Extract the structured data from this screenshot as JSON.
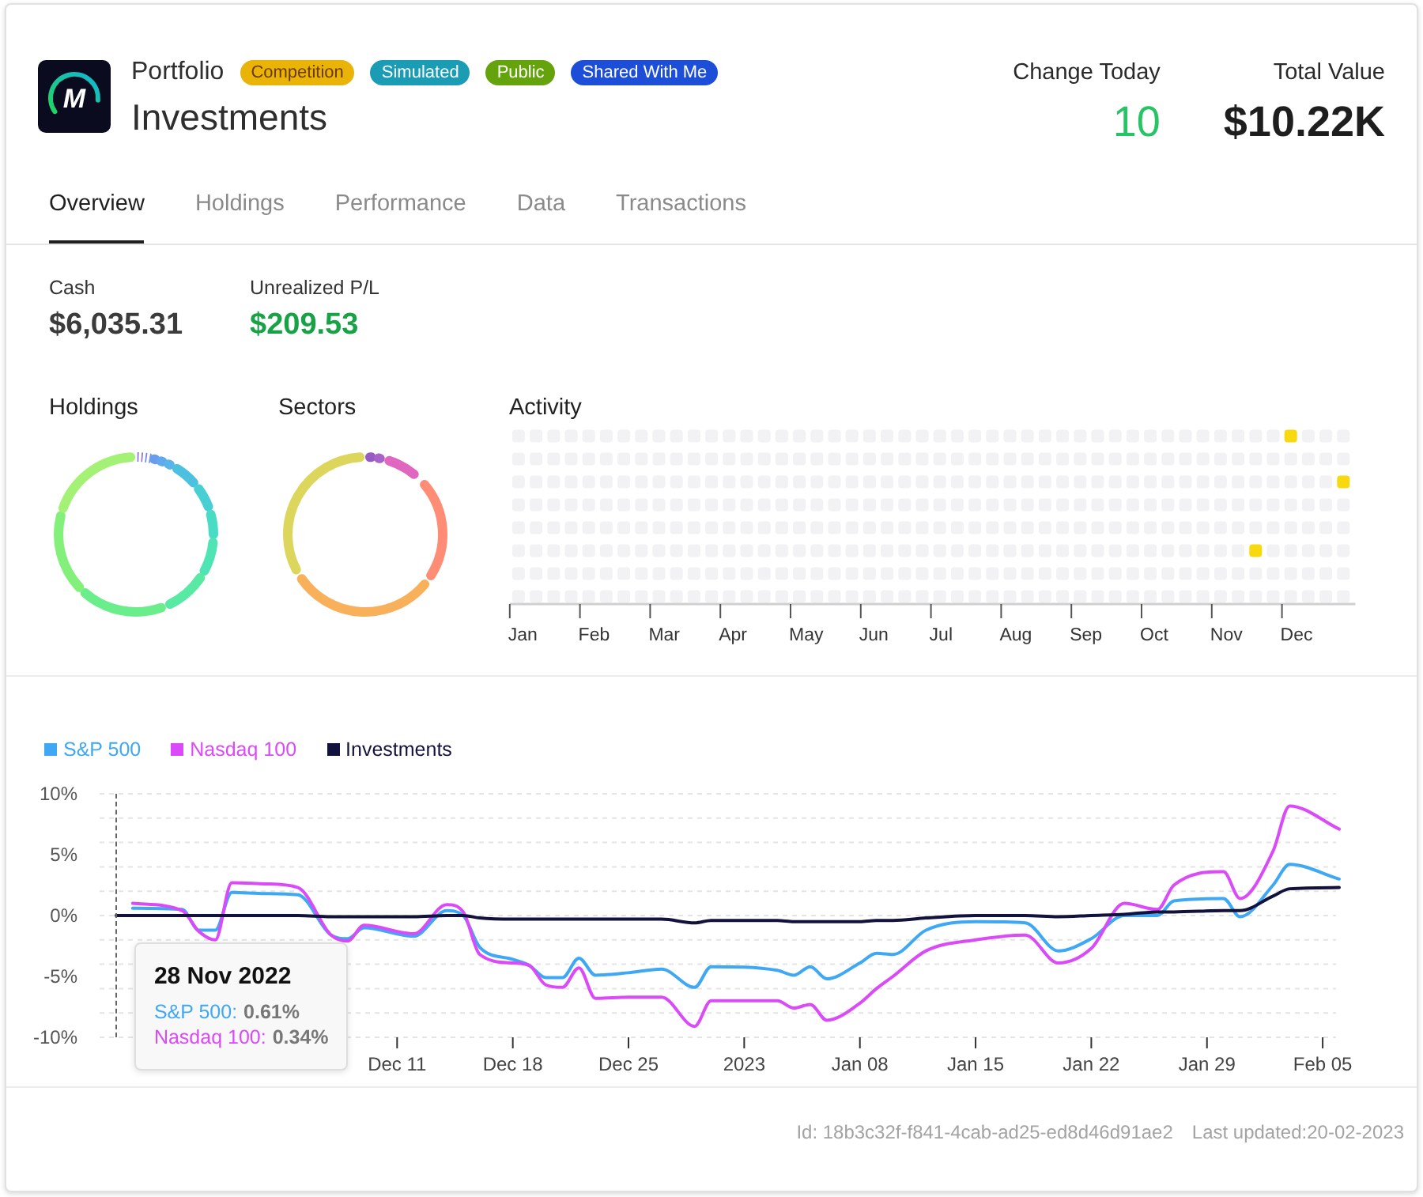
{
  "header": {
    "logo_text": "M",
    "subtitle": "Portfolio",
    "title": "Investments",
    "badges": [
      {
        "label": "Competition",
        "color": "#eab308"
      },
      {
        "label": "Simulated",
        "color": "#1a9cb5"
      },
      {
        "label": "Public",
        "color": "#65a30d"
      },
      {
        "label": "Shared With Me",
        "color": "#1d4ed8"
      }
    ],
    "stats": [
      {
        "label": "Change Today",
        "value": "10",
        "kind": "change"
      },
      {
        "label": "Total Value",
        "value": "$10.22K",
        "kind": "total"
      }
    ]
  },
  "tabs": [
    {
      "label": "Overview",
      "selected": true
    },
    {
      "label": "Holdings",
      "selected": false
    },
    {
      "label": "Performance",
      "selected": false
    },
    {
      "label": "Data",
      "selected": false
    },
    {
      "label": "Transactions",
      "selected": false
    }
  ],
  "metrics": [
    {
      "label": "Cash",
      "value": "$6,035.31",
      "kind": "balance"
    },
    {
      "label": "Unrealized P/L",
      "value": "$209.53",
      "kind": "gain"
    }
  ],
  "holdings": {
    "title": "Holdings"
  },
  "sectors": {
    "title": "Sectors"
  },
  "activity": {
    "title": "Activity",
    "months": [
      "Jan",
      "Feb",
      "Mar",
      "Apr",
      "May",
      "Jun",
      "Jul",
      "Aug",
      "Sep",
      "Oct",
      "Nov",
      "Dec"
    ],
    "grid": [
      [
        false,
        false,
        false,
        false,
        false,
        false,
        false,
        false,
        false,
        false,
        false,
        false,
        false,
        false,
        false,
        false,
        false,
        false,
        false,
        false,
        false,
        false,
        false,
        false,
        false,
        false,
        false,
        false,
        false,
        false,
        false,
        false,
        false,
        false,
        false,
        false,
        false,
        false,
        false,
        false,
        false,
        false,
        false,
        false,
        true,
        false,
        false,
        false
      ],
      [
        false,
        false,
        false,
        false,
        false,
        false,
        false,
        false,
        false,
        false,
        false,
        false,
        false,
        false,
        false,
        false,
        false,
        false,
        false,
        false,
        false,
        false,
        false,
        false,
        false,
        false,
        false,
        false,
        false,
        false,
        false,
        false,
        false,
        false,
        false,
        false,
        false,
        false,
        false,
        false,
        false,
        false,
        false,
        false,
        false,
        false,
        false,
        false
      ],
      [
        false,
        false,
        false,
        false,
        false,
        false,
        false,
        false,
        false,
        false,
        false,
        false,
        false,
        false,
        false,
        false,
        false,
        false,
        false,
        false,
        false,
        false,
        false,
        false,
        false,
        false,
        false,
        false,
        false,
        false,
        false,
        false,
        false,
        false,
        false,
        false,
        false,
        false,
        false,
        false,
        false,
        false,
        false,
        false,
        false,
        false,
        false,
        true
      ],
      [
        false,
        false,
        false,
        false,
        false,
        false,
        false,
        false,
        false,
        false,
        false,
        false,
        false,
        false,
        false,
        false,
        false,
        false,
        false,
        false,
        false,
        false,
        false,
        false,
        false,
        false,
        false,
        false,
        false,
        false,
        false,
        false,
        false,
        false,
        false,
        false,
        false,
        false,
        false,
        false,
        false,
        false,
        false,
        false,
        false,
        false,
        false,
        false
      ],
      [
        false,
        false,
        false,
        false,
        false,
        false,
        false,
        false,
        false,
        false,
        false,
        false,
        false,
        false,
        false,
        false,
        false,
        false,
        false,
        false,
        false,
        false,
        false,
        false,
        false,
        false,
        false,
        false,
        false,
        false,
        false,
        false,
        false,
        false,
        false,
        false,
        false,
        false,
        false,
        false,
        false,
        false,
        false,
        false,
        false,
        false,
        false,
        false
      ],
      [
        false,
        false,
        false,
        false,
        false,
        false,
        false,
        false,
        false,
        false,
        false,
        false,
        false,
        false,
        false,
        false,
        false,
        false,
        false,
        false,
        false,
        false,
        false,
        false,
        false,
        false,
        false,
        false,
        false,
        false,
        false,
        false,
        false,
        false,
        false,
        false,
        false,
        false,
        false,
        false,
        false,
        false,
        true,
        false,
        false,
        false,
        false,
        false
      ],
      [
        false,
        false,
        false,
        false,
        false,
        false,
        false,
        false,
        false,
        false,
        false,
        false,
        false,
        false,
        false,
        false,
        false,
        false,
        false,
        false,
        false,
        false,
        false,
        false,
        false,
        false,
        false,
        false,
        false,
        false,
        false,
        false,
        false,
        false,
        false,
        false,
        false,
        false,
        false,
        false,
        false,
        false,
        false,
        false,
        false,
        false,
        false,
        false
      ],
      [
        false,
        false,
        false,
        false,
        false,
        false,
        false,
        false,
        false,
        false,
        false,
        false,
        false,
        false,
        false,
        false,
        false,
        false,
        false,
        false,
        false,
        false,
        false,
        false,
        false,
        false,
        false,
        false,
        false,
        false,
        false,
        false,
        false,
        false,
        false,
        false,
        false,
        false,
        false,
        false,
        false,
        false,
        false,
        false,
        false,
        false,
        false,
        false
      ]
    ]
  },
  "performance_chart": {
    "chart_data": {
      "type": "line",
      "x": [
        "2022-11-24",
        "2022-11-25",
        "2022-11-28",
        "2022-11-29",
        "2022-11-30",
        "2022-12-01",
        "2022-12-03",
        "2022-12-05",
        "2022-12-07",
        "2022-12-08",
        "2022-12-09",
        "2022-12-12",
        "2022-12-14",
        "2022-12-15",
        "2022-12-16",
        "2022-12-18",
        "2022-12-19",
        "2022-12-20",
        "2022-12-21",
        "2022-12-22",
        "2022-12-23",
        "2022-12-25",
        "2022-12-27",
        "2022-12-29",
        "2022-12-30",
        "2023-01-03",
        "2023-01-04",
        "2023-01-05",
        "2023-01-06",
        "2023-01-08",
        "2023-01-09",
        "2023-01-10",
        "2023-01-12",
        "2023-01-15",
        "2023-01-18",
        "2023-01-20",
        "2023-01-22",
        "2023-01-24",
        "2023-01-26",
        "2023-01-27",
        "2023-01-30",
        "2023-01-31",
        "2023-02-02",
        "2023-02-03",
        "2023-02-06"
      ],
      "series": [
        {
          "name": "S&P 500",
          "color": "#3ea8f5",
          "values": [
            null,
            0.6,
            0.5,
            -1.2,
            -1.2,
            1.9,
            1.8,
            1.7,
            -1.6,
            -1.9,
            -1.0,
            -1.7,
            0.4,
            0.0,
            -2.6,
            -3.6,
            -4.1,
            -5.1,
            -5.1,
            -3.5,
            -4.9,
            -4.7,
            -4.4,
            -5.9,
            -4.2,
            -4.5,
            -4.9,
            -4.2,
            -5.2,
            -3.9,
            -3.1,
            -3.2,
            -1.2,
            -0.5,
            -0.6,
            -2.9,
            -1.9,
            0.0,
            0.0,
            1.2,
            1.4,
            -0.1,
            2.5,
            4.2,
            3.0
          ]
        },
        {
          "name": "Nasdaq 100",
          "color": "#db4af8",
          "values": [
            null,
            1.0,
            0.4,
            -1.3,
            -2.0,
            2.7,
            2.6,
            2.3,
            -1.6,
            -2.1,
            -0.8,
            -1.5,
            0.9,
            0.3,
            -3.2,
            -3.9,
            -4.1,
            -5.7,
            -5.9,
            -4.3,
            -6.8,
            -6.7,
            -6.7,
            -9.1,
            -7.0,
            -7.0,
            -7.6,
            -7.3,
            -8.6,
            -7.2,
            -6.0,
            -5.0,
            -2.9,
            -2.0,
            -1.6,
            -3.9,
            -2.7,
            1.0,
            0.5,
            2.5,
            3.6,
            1.4,
            5.3,
            9.0,
            7.1
          ]
        },
        {
          "name": "Investments",
          "color": "#12123d",
          "values": [
            0,
            0,
            0,
            0,
            0,
            0,
            0,
            0,
            -0.1,
            -0.1,
            -0.1,
            -0.1,
            0,
            0,
            -0.2,
            -0.3,
            -0.3,
            -0.3,
            -0.3,
            -0.3,
            -0.3,
            -0.3,
            -0.3,
            -0.6,
            -0.4,
            -0.4,
            -0.5,
            -0.5,
            -0.5,
            -0.5,
            -0.4,
            -0.4,
            -0.2,
            0,
            0,
            -0.1,
            0,
            0.1,
            0.3,
            0.3,
            0.4,
            0.4,
            1.6,
            2.2,
            2.3
          ]
        }
      ],
      "xlim": [
        "2022-11-23",
        "2023-02-06"
      ],
      "ylim": [
        -10,
        10
      ],
      "xticks": [
        {
          "value": "2022-12-11",
          "label": "Dec 11"
        },
        {
          "value": "2022-12-18",
          "label": "Dec 18"
        },
        {
          "value": "2022-12-25",
          "label": "Dec 25"
        },
        {
          "value": "2023-01-01",
          "label": "2023"
        },
        {
          "value": "2023-01-08",
          "label": "Jan 08"
        },
        {
          "value": "2023-01-15",
          "label": "Jan 15"
        },
        {
          "value": "2023-01-22",
          "label": "Jan 22"
        },
        {
          "value": "2023-01-29",
          "label": "Jan 29"
        },
        {
          "value": "2023-02-05",
          "label": "Feb 05"
        }
      ],
      "yticks": [
        {
          "value": 10,
          "label": "10%"
        },
        {
          "value": 5,
          "label": "5%"
        },
        {
          "value": 0,
          "label": "0%"
        },
        {
          "value": -5,
          "label": "-5%"
        },
        {
          "value": -10,
          "label": "-10%"
        }
      ]
    },
    "tooltip": {
      "title": "28 Nov 2022",
      "items": [
        {
          "label": "S&P 500:",
          "value": "0.61%"
        },
        {
          "label": "Nasdaq 100:",
          "value": "0.34%"
        }
      ]
    }
  },
  "footer": {
    "id": "Id: 18b3c32f-f841-4cab-ad25-ed8d46d91ae2",
    "last_updated": "Last updated:20-02-2023"
  }
}
